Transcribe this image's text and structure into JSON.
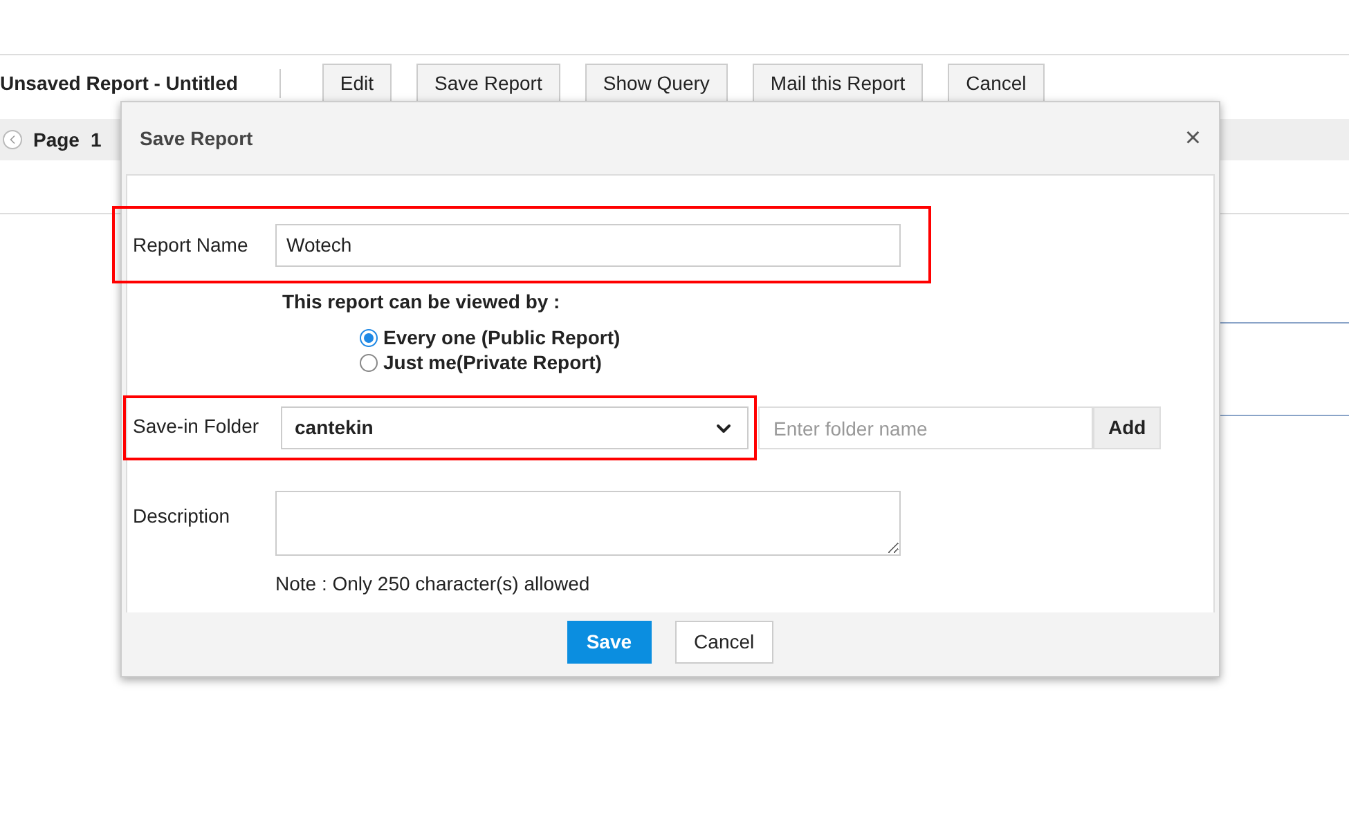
{
  "report_title": "Unsaved Report - Untitled",
  "toolbar": [
    {
      "label": "Edit"
    },
    {
      "label": "Save Report"
    },
    {
      "label": "Show Query"
    },
    {
      "label": "Mail this Report"
    },
    {
      "label": "Cancel"
    }
  ],
  "pager": {
    "label": "Page",
    "value": "1"
  },
  "dialog": {
    "title": "Save Report",
    "close": "×",
    "report_name": {
      "label": "Report Name",
      "value": "Wotech",
      "highlighted": true
    },
    "visibility": {
      "label": "This report can be viewed by :",
      "options": [
        {
          "label": "Every one (Public Report)",
          "selected": true
        },
        {
          "label": "Just me(Private Report)",
          "selected": false
        }
      ]
    },
    "folder": {
      "label": "Save-in Folder",
      "value": "cantekin",
      "highlighted": true,
      "new_folder_placeholder": "Enter folder name",
      "add": "Add"
    },
    "description": {
      "label": "Description",
      "note": "Note : Only 250 character(s) allowed"
    },
    "buttons": [
      {
        "label": "Save",
        "kind": "primary"
      },
      {
        "label": "Cancel",
        "kind": "secondary"
      }
    ]
  }
}
